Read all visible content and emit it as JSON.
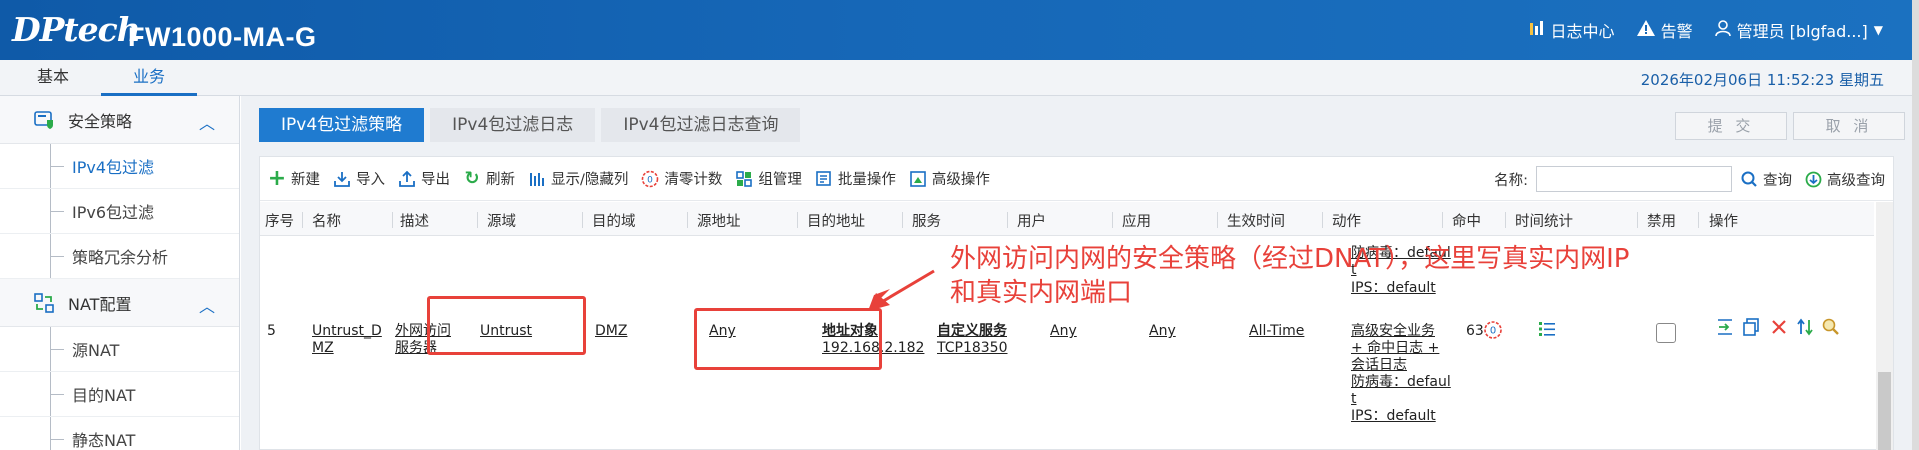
{
  "header": {
    "logo": "DPtech",
    "product": "FW1000-MA-G",
    "log_center": "日志中心",
    "alarm": "告警",
    "admin": "管理员 [blgfad...]"
  },
  "topnav": {
    "tabs": [
      "基本",
      "业务"
    ],
    "active": 1
  },
  "datetime": "2026年02月06日  11:52:23  星期五",
  "sidebar": {
    "groups": [
      {
        "label": "安全策略",
        "items": [
          "IPv4包过滤",
          "IPv6包过滤",
          "策略冗余分析"
        ]
      },
      {
        "label": "NAT配置",
        "items": [
          "源NAT",
          "目的NAT",
          "静态NAT"
        ]
      }
    ],
    "active_item": "IPv4包过滤"
  },
  "tabs": [
    "IPv4包过滤策略",
    "IPv4包过滤日志",
    "IPv4包过滤日志查询"
  ],
  "buttons": {
    "submit": "提 交",
    "cancel": "取 消"
  },
  "toolbar": {
    "new": "新建",
    "import": "导入",
    "export": "导出",
    "refresh": "刷新",
    "columns": "显示/隐藏列",
    "clear": "清零计数",
    "group": "组管理",
    "batch": "批量操作",
    "advanced": "高级操作"
  },
  "search": {
    "label": "名称:",
    "query": "查询",
    "advanced": "高级查询"
  },
  "columns": [
    "序号",
    "名称",
    "描述",
    "源域",
    "目的域",
    "源地址",
    "目的地址",
    "服务",
    "用户",
    "应用",
    "生效时间",
    "动作",
    "命中",
    "时间统计",
    "禁用",
    "操作"
  ],
  "prev_row_fragment": {
    "line1": "防病毒：defaul",
    "line2": "t",
    "line3": "IPS：default"
  },
  "row": {
    "index": "5",
    "name_line1": "Untrust_D",
    "name_line2": "MZ",
    "desc_line1": "外网访问",
    "desc_line2": "服务器",
    "src_zone": "Untrust",
    "dst_zone": "DMZ",
    "src_addr": "Any",
    "dst_addr_label": "地址对象",
    "dst_addr_value": "192.168.2.182",
    "service_label": "自定义服务",
    "service_value": "TCP18350",
    "user": "Any",
    "app": "Any",
    "time": "All-Time",
    "action": [
      "高级安全业务",
      "+ 命中日志 +",
      "会话日志",
      "防病毒：defaul",
      "t",
      "IPS：default"
    ],
    "hits": "63"
  },
  "annotation": {
    "line1": "外网访问内网的安全策略（经过DNAT），这里写真实内网IP",
    "line2": "和真实内网端口"
  },
  "colors": {
    "accent": "#1f7bd0",
    "header": "#1667b7",
    "annotation": "#e8413a"
  }
}
